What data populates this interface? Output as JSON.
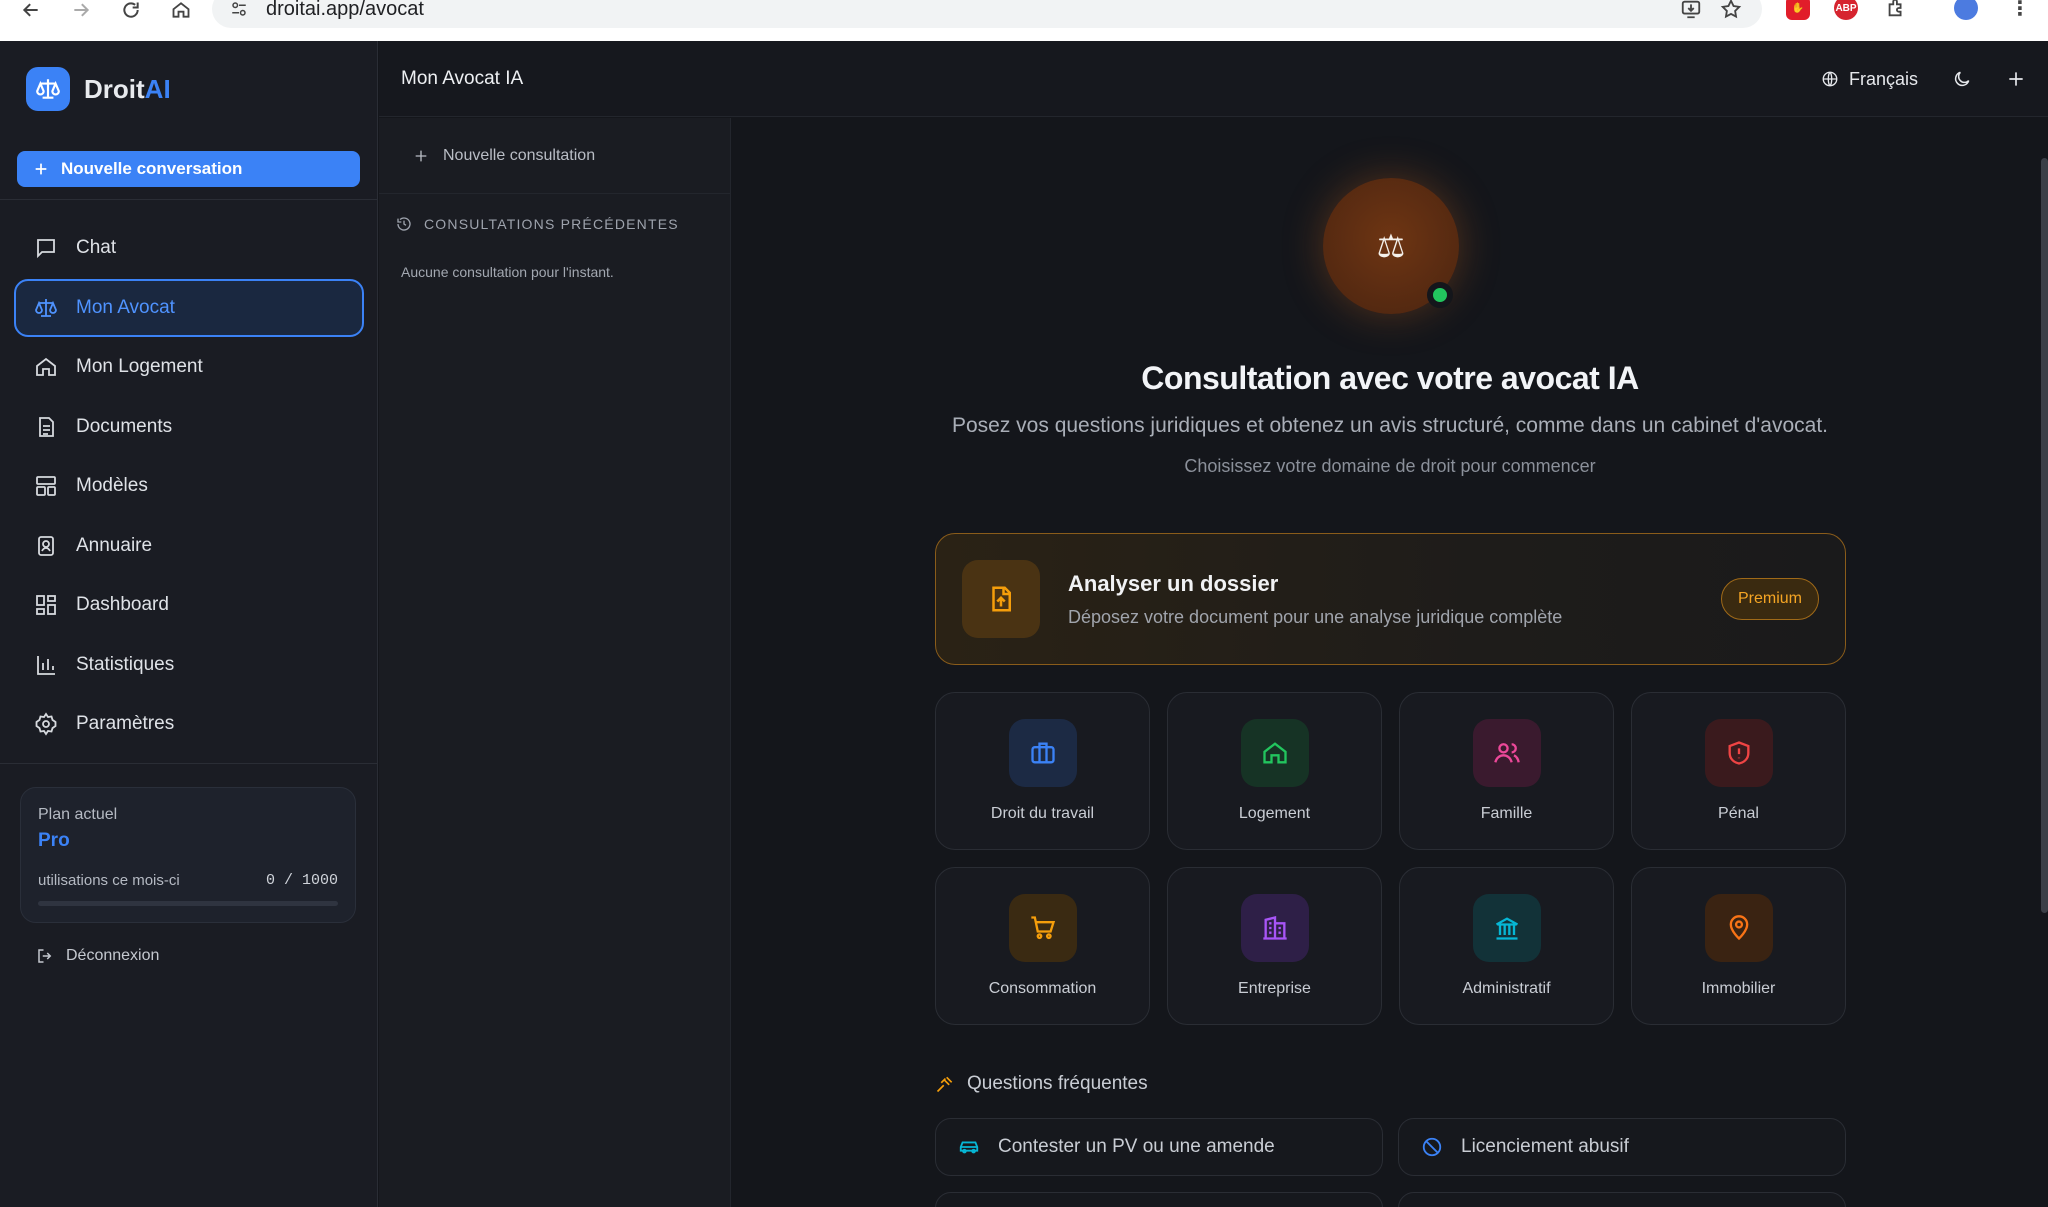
{
  "browser": {
    "url": "droitai.app/avocat",
    "ext_abp": "ABP"
  },
  "sidebar": {
    "brand_main": "Droit",
    "brand_accent": "AI",
    "new_conversation": "Nouvelle conversation",
    "items": [
      {
        "label": "Chat",
        "icon": "chat-icon",
        "active": false
      },
      {
        "label": "Mon Avocat",
        "icon": "scales-icon",
        "active": true
      },
      {
        "label": "Mon Logement",
        "icon": "home-icon",
        "active": false
      },
      {
        "label": "Documents",
        "icon": "document-icon",
        "active": false
      },
      {
        "label": "Modèles",
        "icon": "templates-icon",
        "active": false
      },
      {
        "label": "Annuaire",
        "icon": "directory-icon",
        "active": false
      },
      {
        "label": "Dashboard",
        "icon": "dashboard-icon",
        "active": false
      },
      {
        "label": "Statistiques",
        "icon": "stats-icon",
        "active": false
      },
      {
        "label": "Paramètres",
        "icon": "gear-icon",
        "active": false
      }
    ],
    "plan": {
      "label": "Plan actuel",
      "name": "Pro",
      "usage_label": "utilisations ce mois-ci",
      "usage_count": "0 / 1000",
      "usage_fraction": 0
    },
    "logout": "Déconnexion"
  },
  "topbar": {
    "title": "Mon Avocat IA",
    "language": "Français"
  },
  "history": {
    "new_consultation": "Nouvelle consultation",
    "heading": "CONSULTATIONS PRÉCÉDENTES",
    "empty": "Aucune consultation pour l'instant."
  },
  "main": {
    "heading": "Consultation avec votre avocat IA",
    "subtitle": "Posez vos questions juridiques et obtenez un avis structuré, comme dans un cabinet d'avocat.",
    "hint": "Choisissez votre domaine de droit pour commencer",
    "analyze": {
      "title": "Analyser un dossier",
      "description": "Déposez votre document pour une analyse juridique complète",
      "badge": "Premium"
    },
    "domains": [
      {
        "label": "Droit du travail",
        "icon": "briefcase-icon",
        "color": "#3b82f6"
      },
      {
        "label": "Logement",
        "icon": "home-icon",
        "color": "#22c55e"
      },
      {
        "label": "Famille",
        "icon": "users-icon",
        "color": "#ec4899"
      },
      {
        "label": "Pénal",
        "icon": "shield-alert-icon",
        "color": "#ef4444"
      },
      {
        "label": "Consommation",
        "icon": "cart-icon",
        "color": "#f59e0b"
      },
      {
        "label": "Entreprise",
        "icon": "building-icon",
        "color": "#a855f7"
      },
      {
        "label": "Administratif",
        "icon": "landmark-icon",
        "color": "#06b6d4"
      },
      {
        "label": "Immobilier",
        "icon": "map-pin-icon",
        "color": "#f97316"
      }
    ],
    "faq_heading": "Questions fréquentes",
    "faq": [
      {
        "label": "Contester un PV ou une amende",
        "icon": "car-icon"
      },
      {
        "label": "Licenciement abusif",
        "icon": "ban-icon"
      }
    ]
  }
}
